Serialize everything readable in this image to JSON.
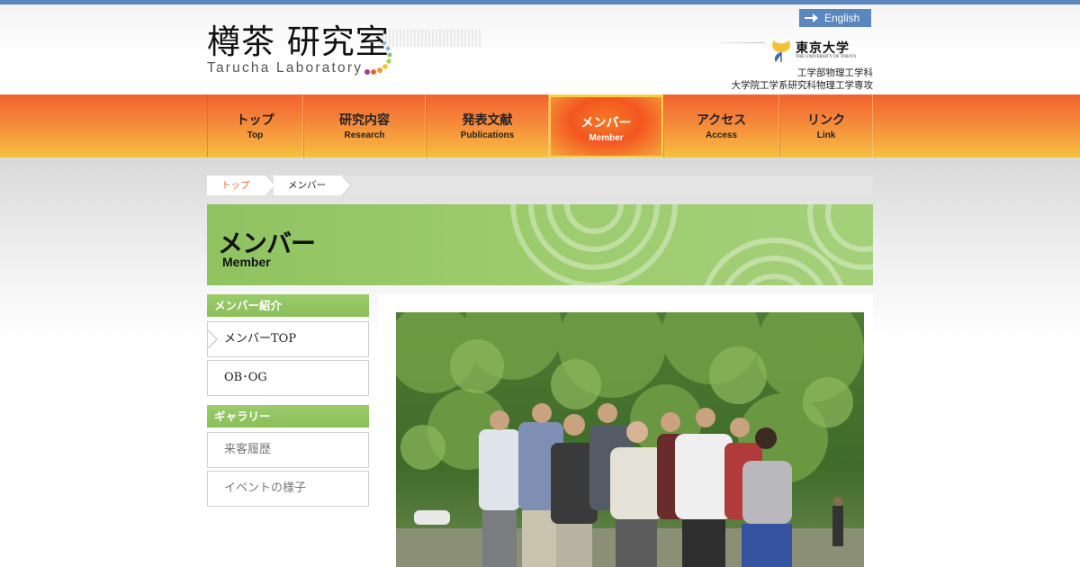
{
  "header": {
    "logo_jp": "樽茶 研究室",
    "logo_en": "Tarucha Laboratory",
    "english_label": "English",
    "university_name": "東京大学",
    "university_sub": "THE UNIVERSITY OF TOKYO",
    "dept_line1": "工学部物理工学科",
    "dept_line2": "大学院工学系研究科物理工学専攻"
  },
  "nav": {
    "items": [
      {
        "jp": "トップ",
        "en": "Top"
      },
      {
        "jp": "研究内容",
        "en": "Research"
      },
      {
        "jp": "発表文献",
        "en": "Publications"
      },
      {
        "jp": "メンバー",
        "en": "Member"
      },
      {
        "jp": "アクセス",
        "en": "Access"
      },
      {
        "jp": "リンク",
        "en": "Link"
      }
    ],
    "active_index": 3
  },
  "breadcrumb": {
    "items": [
      "トップ",
      "メンバー"
    ]
  },
  "banner": {
    "title_jp": "メンバー",
    "title_en": "Member"
  },
  "sidebar": {
    "section1_heading": "メンバー紹介",
    "section1_items": [
      "メンバーTOP",
      "OB･OG"
    ],
    "section2_heading": "ギャラリー",
    "section2_items": [
      "来客履歴",
      "イベントの様子"
    ]
  },
  "colors": {
    "brand_blue": "#5b86bf",
    "nav_orange": "#f5843a",
    "accent_green": "#9ccb6c",
    "breadcrumb_link": "#e8642c"
  }
}
